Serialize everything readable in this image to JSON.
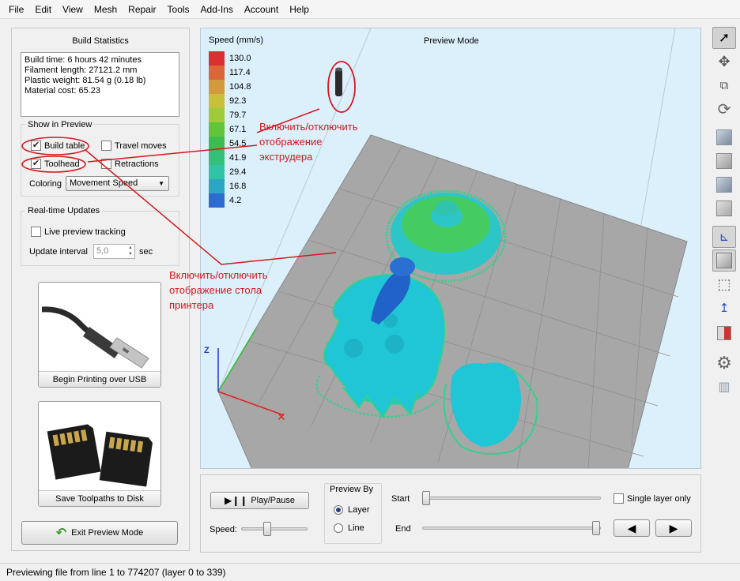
{
  "menu": [
    "File",
    "Edit",
    "View",
    "Mesh",
    "Repair",
    "Tools",
    "Add-Ins",
    "Account",
    "Help"
  ],
  "build_stats": {
    "title": "Build Statistics",
    "lines": [
      "Build time: 6 hours 42 minutes",
      "Filament length: 27121.2 mm",
      "Plastic weight: 81.54 g (0.18 lb)",
      "Material cost: 65.23"
    ]
  },
  "show_in_preview": {
    "title": "Show in Preview",
    "build_table": {
      "label": "Build table",
      "checked": true
    },
    "travel_moves": {
      "label": "Travel moves",
      "checked": false
    },
    "toolhead": {
      "label": "Toolhead",
      "checked": true
    },
    "retractions": {
      "label": "Retractions",
      "checked": false
    },
    "coloring_label": "Coloring",
    "coloring_value": "Movement Speed"
  },
  "realtime": {
    "title": "Real-time Updates",
    "live_label": "Live preview tracking",
    "interval_label": "Update interval",
    "interval_value": "5,0",
    "unit": "sec"
  },
  "usb_button": {
    "label": "Begin Printing over USB"
  },
  "disk_button": {
    "label": "Save Toolpaths to Disk"
  },
  "exit_button": {
    "label": "Exit Preview Mode"
  },
  "viewport": {
    "mode_label": "Preview Mode",
    "legend_title": "Speed (mm/s)",
    "legend": [
      {
        "value": "130.0",
        "color": "#d9312f"
      },
      {
        "value": "117.4",
        "color": "#d9673a"
      },
      {
        "value": "104.8",
        "color": "#d29a3c"
      },
      {
        "value": "92.3",
        "color": "#c8c03b"
      },
      {
        "value": "79.7",
        "color": "#9fcb3a"
      },
      {
        "value": "67.1",
        "color": "#61c43b"
      },
      {
        "value": "54.5",
        "color": "#3dbd50"
      },
      {
        "value": "41.9",
        "color": "#35c07a"
      },
      {
        "value": "29.4",
        "color": "#31c3a6"
      },
      {
        "value": "16.8",
        "color": "#2ba7c5"
      },
      {
        "value": "4.2",
        "color": "#2d6bd0"
      }
    ],
    "axis_z": "Z"
  },
  "annotations": {
    "extruder": [
      "Включить/отключить",
      "отображение",
      "экструдера"
    ],
    "table": [
      "Включить/отключить",
      "отображение стола",
      "принтера"
    ]
  },
  "playback": {
    "play_label": "Play/Pause",
    "speed_label": "Speed:",
    "preview_by_title": "Preview By",
    "layer_label": "Layer",
    "line_label": "Line",
    "selected": "Layer",
    "start_label": "Start",
    "end_label": "End",
    "single_layer_label": "Single layer only"
  },
  "status": "Previewing file from line 1 to 774207 (layer 0 to 339)"
}
